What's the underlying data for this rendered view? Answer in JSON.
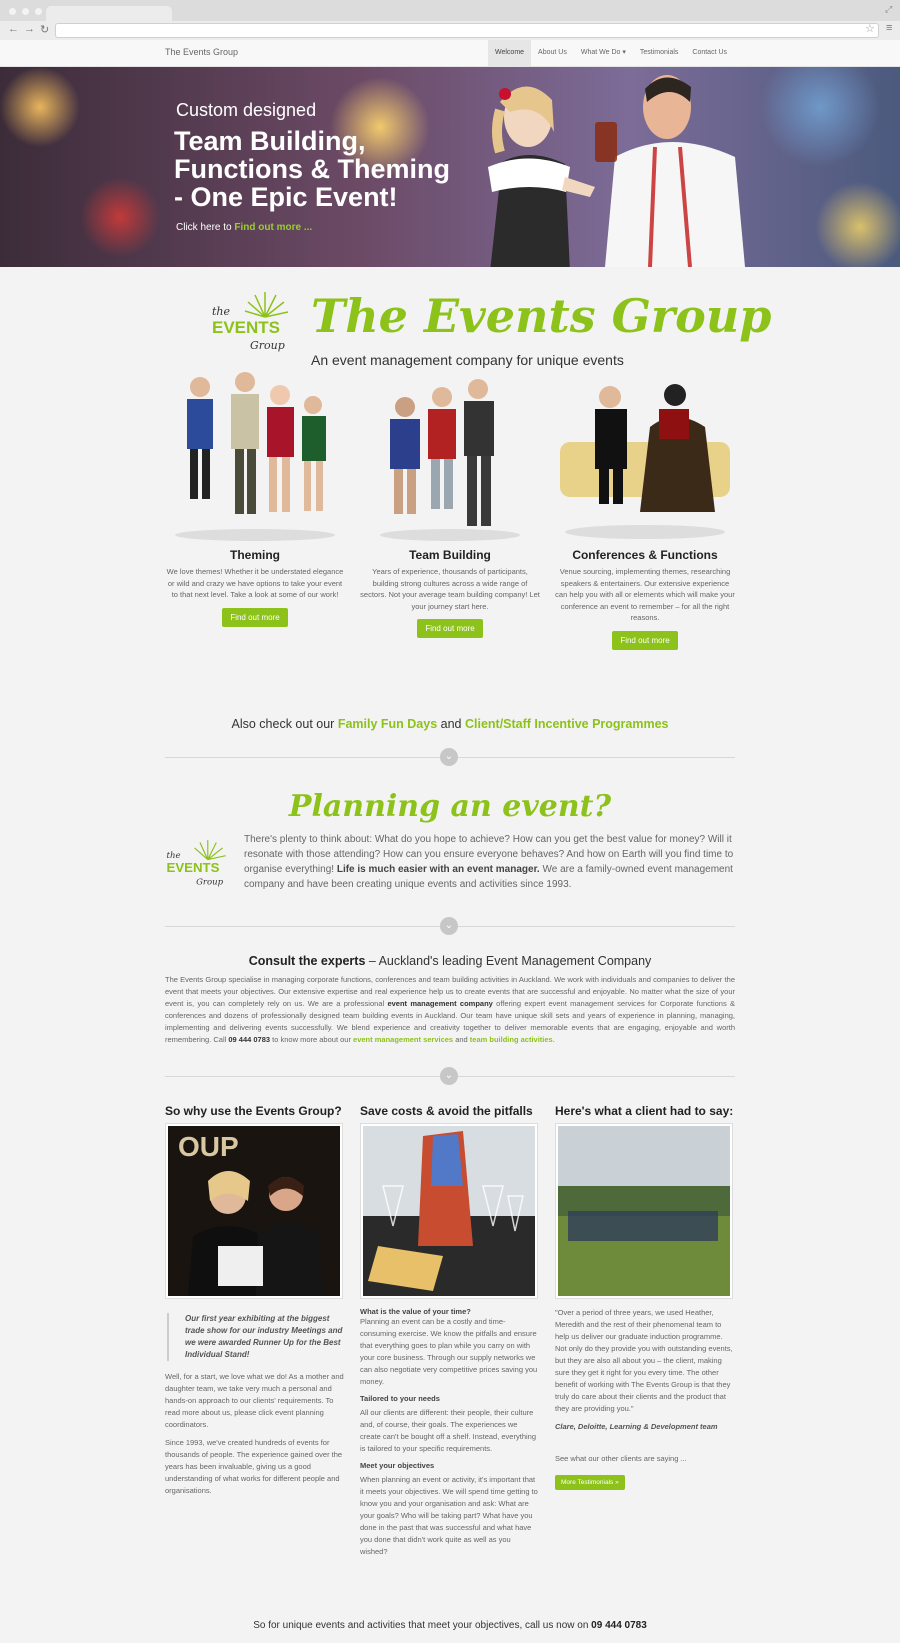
{
  "browser": {
    "star_icon": "star-icon",
    "menu_icon": "hamburger-icon"
  },
  "site": {
    "brand": "The Events Group",
    "nav": [
      "Welcome",
      "About Us",
      "What We Do",
      "Testimonials",
      "Contact Us"
    ]
  },
  "hero": {
    "sub": "Custom designed",
    "title": "Team Building, Functions & Theming - One Epic Event!",
    "cta_prefix": "Click here to ",
    "cta_link": "Find out more ..."
  },
  "intro": {
    "logo_text": "the EVENTS Group",
    "name": "The Events Group",
    "tagline": "An event management company for unique events"
  },
  "services": [
    {
      "title": "Theming",
      "text": "We love themes! Whether it be understated elegance or wild and crazy we have options to take your event to that next level. Take a look at some of our work!",
      "button": "Find out more"
    },
    {
      "title": "Team Building",
      "text": "Years of experience, thousands of participants, building strong cultures across a wide range of sectors. Not your average team building company! Let your journey start here.",
      "button": "Find out more"
    },
    {
      "title": "Conferences & Functions",
      "text": "Venue sourcing, implementing themes, researching speakers & entertainers. Our extensive experience can help you with all or elements which will make your conference an event to remember – for all the right reasons.",
      "button": "Find out more"
    }
  ],
  "also": {
    "prefix": "Also check out our ",
    "link1": "Family Fun Days",
    "mid": " and ",
    "link2": "Client/Staff Incentive Programmes"
  },
  "planning": {
    "title": "Planning an event?",
    "text_1": "There's plenty to think about: What do you hope to achieve? How can you get the best value for money? Will it resonate with those attending? How can you ensure everyone behaves? And how on Earth will you find time to organise everything! ",
    "bold": "Life is much easier with an event manager.",
    "text_2": " We are a family-owned event management company and have been creating unique events and activities since 1993."
  },
  "consult": {
    "title_bold": "Consult the experts",
    "title_rest": " – Auckland's leading Event Management Company",
    "p1": "The Events Group specialise in managing corporate functions, conferences and team building activities in Auckland. We work with individuals and companies to deliver the event that meets your objectives. Our extensive expertise and real experience help us to create events that are successful and enjoyable. No matter what the size of your event is, you can completely rely on us. We are a professional ",
    "b1": "event management company",
    "p2": " offering expert event management services for Corporate functions & conferences and dozens of professionally designed team building events in Auckland. Our team have unique skill sets and years of experience in planning, managing, implementing and delivering events successfully. We blend experience and creativity together to deliver memorable events that are engaging, enjoyable and worth remembering. Call ",
    "phone": "09 444 0783",
    "p3": " to know more about our ",
    "link1": "event management services",
    "and": " and ",
    "link2": "team building activities",
    "end": "."
  },
  "why": {
    "title": "So why use the Events Group?",
    "quote": "Our first year exhibiting at the biggest trade show for our industry Meetings and we were awarded Runner Up for the Best Individual Stand!",
    "p1": "Well, for a start, we love what we do! As a mother and daughter team, we take very much a personal and hands-on approach to our clients' requirements. To read more about us, please click event planning coordinators.",
    "p2": "Since 1993, we've created hundreds of events for thousands of people. The experience gained over the years has been invaluable, giving us a good understanding of what works for different people and organisations."
  },
  "save": {
    "title": "Save costs & avoid the pitfalls",
    "h1": "What is the value of your time?",
    "p1": "Planning an event can be a costly and time-consuming exercise. We know the pitfalls and ensure that everything goes to plan while you carry on with your core business. Through our supply networks we can also negotiate very competitive prices saving you money.",
    "h2": "Tailored to your needs",
    "p2": "All our clients are different: their people, their culture and, of course, their goals. The experiences we create can't be bought off a shelf. Instead, everything is tailored to your specific requirements.",
    "h3": "Meet your objectives",
    "p3": "When planning an event or activity, it's important that it meets your objectives. We will spend time getting to know you and your organisation and ask: What are your goals? Who will be taking part? What have you done in the past that was successful and what have you done that didn't work quite as well as you wished?"
  },
  "client": {
    "title": "Here's what a client had to say:",
    "quote": "\"Over a period of three years, we used Heather, Meredith and the rest of their phenomenal team to help us deliver our graduate induction programme. Not only do they provide you with outstanding events, but they are also all about you – the client, making sure they get it right for you every time. The other benefit of working with The Events Group is that they truly do care about their clients and the product that they are providing you.\"",
    "author": "Clare, Deloitte, Learning & Development team",
    "more_text": "See what our other clients are saying ...",
    "button": "More Testimonials »"
  },
  "footer": {
    "text": "So for unique events and activities that meet your objectives, call us now on ",
    "phone": "09 444 0783"
  }
}
